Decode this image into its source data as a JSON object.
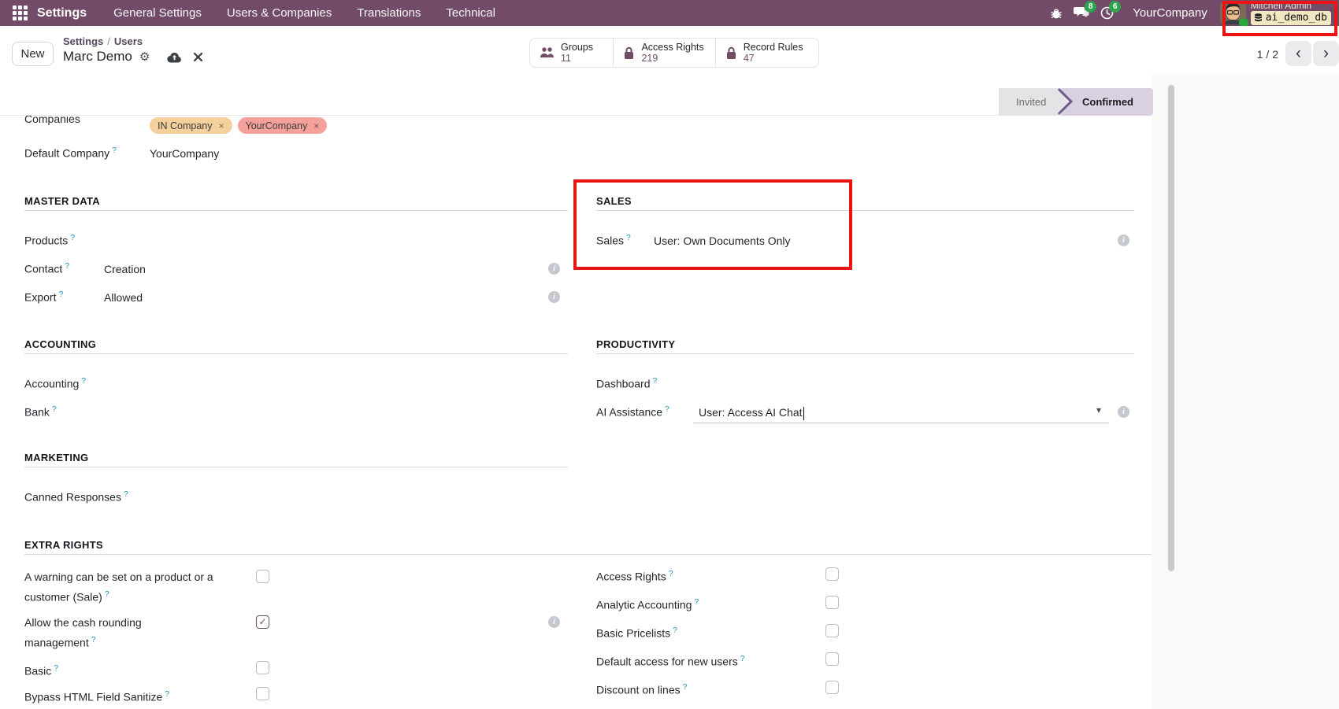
{
  "topbar": {
    "app_name": "Settings",
    "menus": [
      "General Settings",
      "Users & Companies",
      "Translations",
      "Technical"
    ],
    "chat_badge": "8",
    "activity_badge": "6",
    "company": "YourCompany",
    "user_name": "Mitchell Admin",
    "database": "ai_demo_db"
  },
  "control_panel": {
    "new_label": "New",
    "breadcrumb": {
      "parent": "Settings",
      "separator": "/",
      "section": "Users",
      "record": "Marc Demo"
    },
    "stat_buttons": [
      {
        "icon": "users-icon",
        "label": "Groups",
        "value": "11"
      },
      {
        "icon": "lock-icon",
        "label": "Access Rights",
        "value": "219"
      },
      {
        "icon": "lock-icon",
        "label": "Record Rules",
        "value": "47"
      }
    ],
    "pager": {
      "value": "1 / 2"
    }
  },
  "statusbar": {
    "stages": [
      {
        "label": "Invited"
      },
      {
        "label": "Confirmed"
      }
    ],
    "active_stage": "Confirmed"
  },
  "form": {
    "companies": {
      "label": "Companies",
      "tags": [
        "IN Company",
        "YourCompany"
      ]
    },
    "default_company": {
      "label": "Default Company",
      "value": "YourCompany"
    },
    "sections": {
      "master_data": {
        "title": "MASTER DATA",
        "rows": [
          {
            "label": "Products",
            "value": ""
          },
          {
            "label": "Contact",
            "value": "Creation"
          },
          {
            "label": "Export",
            "value": "Allowed"
          }
        ]
      },
      "sales": {
        "title": "SALES",
        "rows": [
          {
            "label": "Sales",
            "value": "User: Own Documents Only"
          }
        ]
      },
      "accounting": {
        "title": "ACCOUNTING",
        "rows": [
          {
            "label": "Accounting",
            "value": ""
          },
          {
            "label": "Bank",
            "value": ""
          }
        ]
      },
      "productivity": {
        "title": "PRODUCTIVITY",
        "rows": [
          {
            "label": "Dashboard",
            "value": ""
          },
          {
            "label": "AI Assistance",
            "value": "User: Access AI Chat"
          }
        ]
      },
      "marketing": {
        "title": "MARKETING",
        "rows": [
          {
            "label": "Canned Responses",
            "value": ""
          }
        ]
      },
      "extra_rights": {
        "title": "EXTRA RIGHTS",
        "left": [
          {
            "label": "A warning can be set on a product or a customer (Sale)",
            "checked": false
          },
          {
            "label": "Allow the cash rounding management",
            "checked": true
          },
          {
            "label": "Basic",
            "checked": false
          },
          {
            "label": "Bypass HTML Field Sanitize",
            "checked": false
          }
        ],
        "right": [
          {
            "label": "Access Rights",
            "checked": false
          },
          {
            "label": "Analytic Accounting",
            "checked": false
          },
          {
            "label": "Basic Pricelists",
            "checked": false
          },
          {
            "label": "Default access for new users",
            "checked": false
          },
          {
            "label": "Discount on lines",
            "checked": false
          }
        ]
      }
    }
  },
  "icons": {
    "help": "?",
    "remove": "×",
    "check": "✓",
    "caret": "▾",
    "prev": "‹",
    "next": "›",
    "gear": "⚙",
    "slash": "/"
  },
  "colors": {
    "brand": "#714B67",
    "badge_green": "#2EA44F",
    "annotation_red": "#EB1414",
    "tag_orange": "#F5CF9C",
    "tag_salmon": "#F5A19B"
  }
}
